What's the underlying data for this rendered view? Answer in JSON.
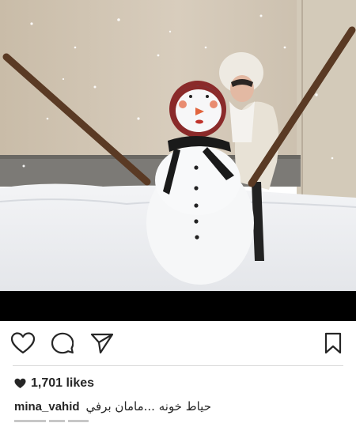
{
  "post": {
    "photo": {
      "description_icon": "snowman-photo",
      "colors": {
        "wall": "#cfc3b1",
        "snow": "#eef0f2",
        "stick": "#5a3a24",
        "scarf": "#1a1a1a"
      }
    },
    "actions": {
      "like_icon": "heart-outline-icon",
      "comment_icon": "comment-bubble-icon",
      "share_icon": "paper-plane-icon",
      "save_icon": "bookmark-icon"
    },
    "likes": {
      "icon": "heart-filled-icon",
      "count_label": "1,701 likes"
    },
    "caption": {
      "username": "mina_vahid",
      "text": "حیاط خونه ...مامان برفي"
    }
  }
}
